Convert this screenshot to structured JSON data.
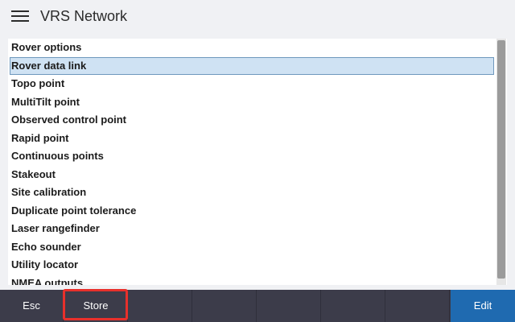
{
  "header": {
    "menu_icon": "hamburger-menu-icon",
    "title": "VRS Network"
  },
  "list": {
    "items": [
      {
        "label": "Rover options",
        "selected": false
      },
      {
        "label": "Rover data link",
        "selected": true
      },
      {
        "label": "Topo point",
        "selected": false
      },
      {
        "label": "MultiTilt point",
        "selected": false
      },
      {
        "label": "Observed control point",
        "selected": false
      },
      {
        "label": "Rapid point",
        "selected": false
      },
      {
        "label": "Continuous points",
        "selected": false
      },
      {
        "label": "Stakeout",
        "selected": false
      },
      {
        "label": "Site calibration",
        "selected": false
      },
      {
        "label": "Duplicate point tolerance",
        "selected": false
      },
      {
        "label": "Laser rangefinder",
        "selected": false
      },
      {
        "label": "Echo sounder",
        "selected": false
      },
      {
        "label": "Utility locator",
        "selected": false
      },
      {
        "label": "NMEA outputs",
        "selected": false
      }
    ]
  },
  "toolbar": {
    "esc_label": "Esc",
    "store_label": "Store",
    "edit_label": "Edit"
  },
  "colors": {
    "toolbar_bg": "#3c3c4a",
    "edit_bg": "#1f6ab0",
    "selection_bg": "#cfe2f3",
    "highlight": "#e8302b"
  }
}
